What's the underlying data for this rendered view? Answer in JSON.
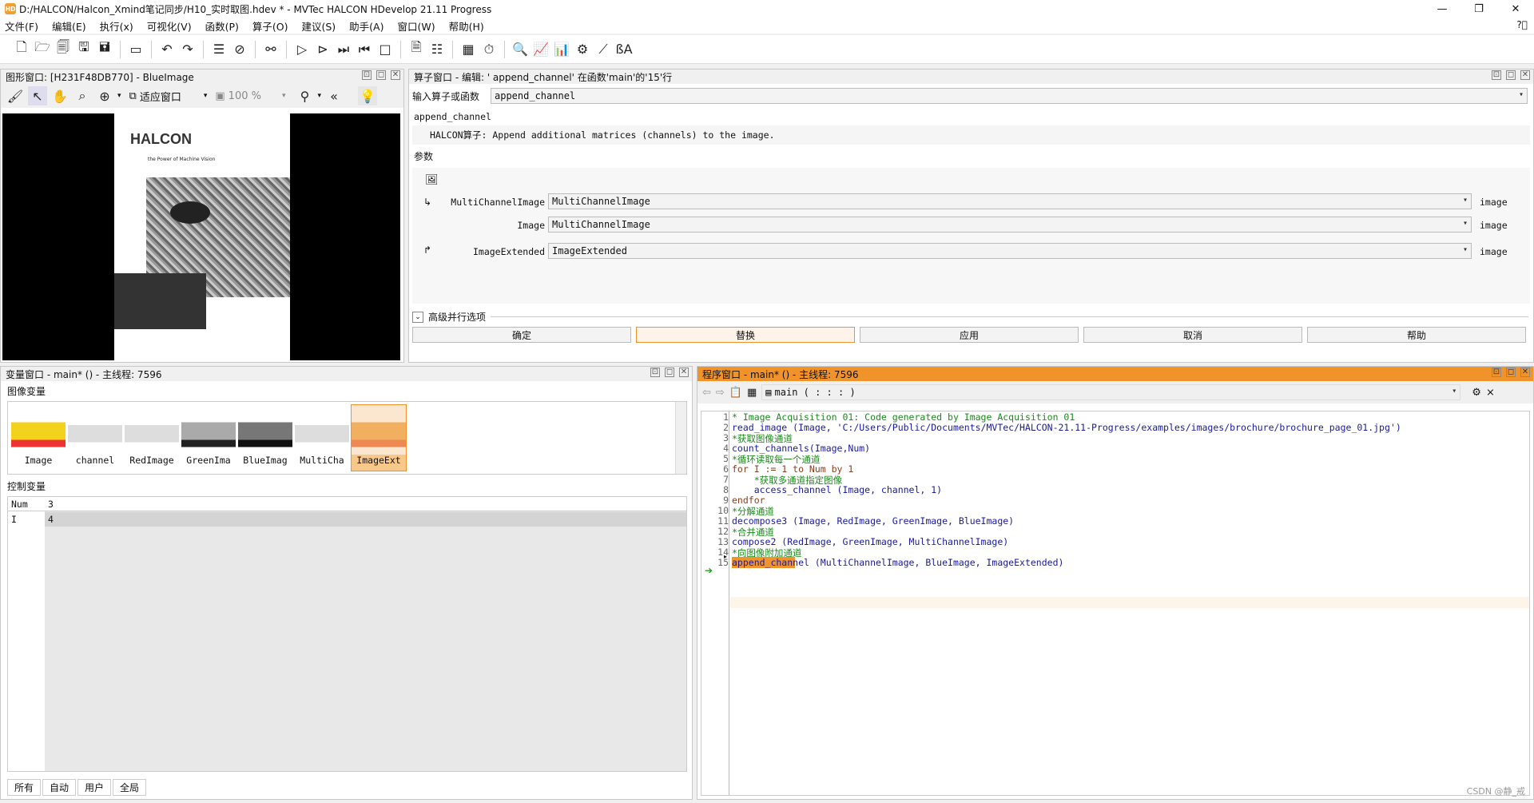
{
  "window": {
    "title": "D:/HALCON/Halcon_Xmind笔记同步/H10_实时取图.hdev * - MVTec HALCON HDevelop 21.11 Progress",
    "app_icon": "HD"
  },
  "menu": [
    "文件(F)",
    "编辑(E)",
    "执行(x)",
    "可视化(V)",
    "函数(P)",
    "算子(O)",
    "建议(S)",
    "助手(A)",
    "窗口(W)",
    "帮助(H)"
  ],
  "graphics": {
    "header": "图形窗口: [H231F48DB770] - BlueImage",
    "fit_label": "适应窗口",
    "zoom": "100 %",
    "doc_logo": "HALCON",
    "doc_tagline": "the Power of Machine Vision"
  },
  "operator": {
    "header": "算子窗口 - 编辑: ' append_channel' 在函数'main'的'15'行",
    "input_label": "输入算子或函数",
    "input_value": "append_channel",
    "op_name": "append_channel",
    "op_desc": "HALCON算子: Append additional matrices (channels) to the image.",
    "params_label": "参数",
    "params": [
      {
        "name": "MultiChannelImage",
        "value": "MultiChannelImage",
        "type": "image"
      },
      {
        "name": "Image",
        "value": "MultiChannelImage",
        "type": "image"
      },
      {
        "name": "ImageExtended",
        "value": "ImageExtended",
        "type": "image"
      }
    ],
    "advanced": "高级并行选项",
    "buttons": [
      "确定",
      "替换",
      "应用",
      "取消",
      "帮助"
    ]
  },
  "variables": {
    "header": "变量窗口 - main* () - 主线程: 7596",
    "image_vars_label": "图像变量",
    "image_vars": [
      "Image",
      "channel",
      "RedImage",
      "GreenIma",
      "BlueImag",
      "MultiCha",
      "ImageExt"
    ],
    "control_vars_label": "控制变量",
    "control_vars": [
      {
        "name": "Num",
        "value": "3"
      },
      {
        "name": "I",
        "value": "4"
      }
    ],
    "tabs": [
      "所有",
      "自动",
      "用户",
      "全局"
    ]
  },
  "program": {
    "header": "程序窗口 - main* () - 主线程: 7596",
    "proc": "main ( : : : )",
    "lines": [
      "* Image Acquisition 01: Code generated by Image Acquisition 01",
      "read_image (Image, 'C:/Users/Public/Documents/MVTec/HALCON-21.11-Progress/examples/images/brochure/brochure_page_01.jpg')",
      "*获取图像通道",
      "count_channels(Image,Num)",
      "*循环读取每一个通道",
      "for I := 1 to Num by 1",
      "    *获取多通道指定图像",
      "    access_channel (Image, channel, 1)",
      "endfor",
      "*分解通道",
      "decompose3 (Image, RedImage, GreenImage, BlueImage)",
      "*合并通道",
      "compose2 (RedImage, GreenImage, MultiChannelImage)",
      "*向图像附加通道",
      "append_channel (MultiChannelImage, BlueImage, ImageExtended)"
    ],
    "line_numbers": [
      "1",
      "2",
      "3",
      "4",
      "5",
      "6",
      "7",
      "8",
      "9",
      "10",
      "11",
      "12",
      "13",
      "14",
      "15"
    ]
  },
  "watermark": "CSDN @静_戒",
  "colors": {
    "accent": "#f0932b",
    "comment": "#1a8a1a",
    "keyword": "#8a3d1e",
    "operator": "#1a1aa0"
  }
}
